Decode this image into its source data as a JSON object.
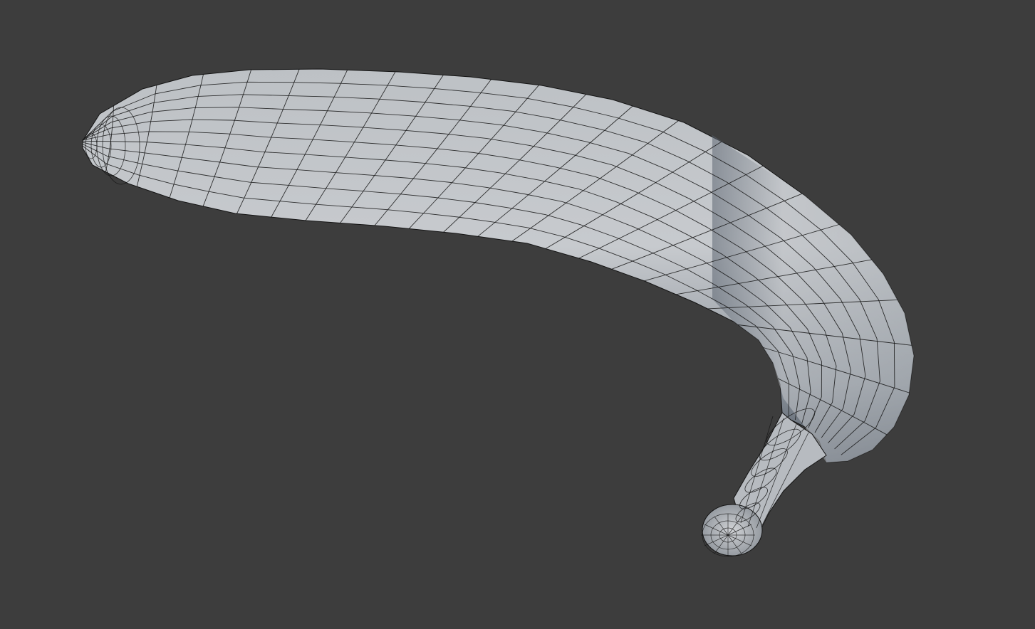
{
  "viewport": {
    "background_color": "#3d3d3d",
    "object_name": "banana",
    "shading": "solid",
    "overlay": "wireframe"
  },
  "colors": {
    "surface_light": "#c9ccd0",
    "surface_mid": "#a9aeb4",
    "surface_shadow": "#4f5864",
    "wire": "#141414"
  }
}
